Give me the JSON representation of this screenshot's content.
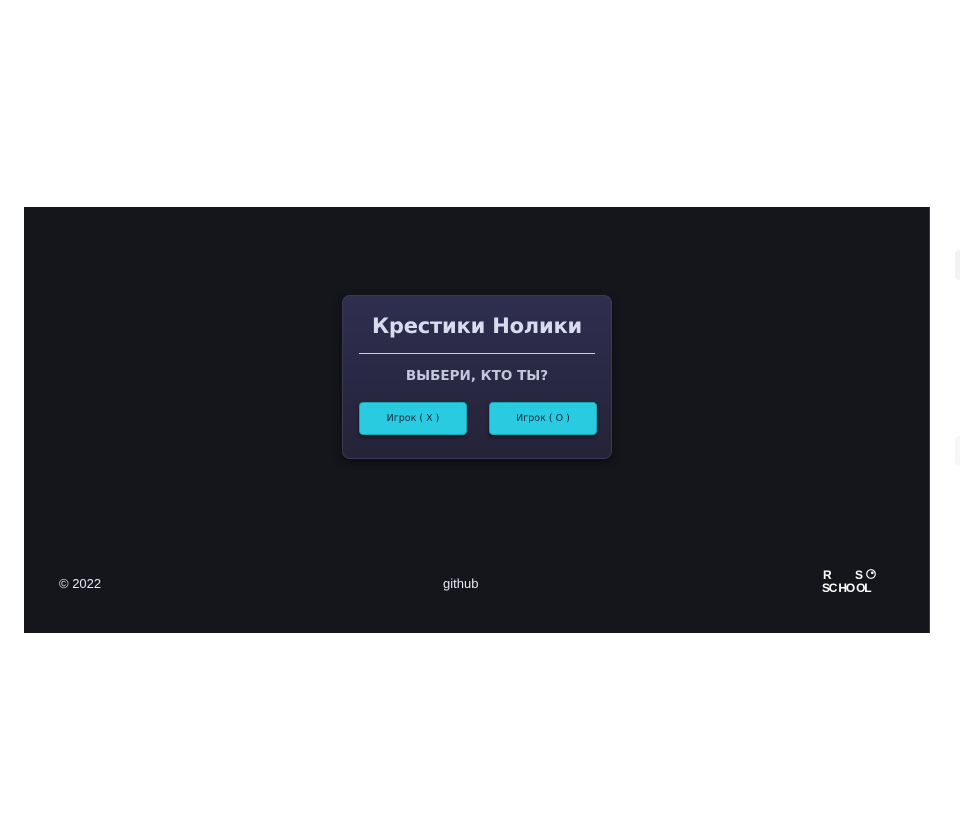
{
  "modal": {
    "title": "Крестики Нолики",
    "subtitle": "ВЫБЕРИ, КТО ТЫ?",
    "buttons": [
      {
        "label": "Игрок ( X )"
      },
      {
        "label": "Игрок ( O )"
      }
    ]
  },
  "footer": {
    "copyright": "© 2022",
    "github_label": "github",
    "logo": {
      "name": "rs-school-logo",
      "line1_left": "R",
      "line1_right": "S",
      "line2": "SC HO OL"
    }
  },
  "colors": {
    "app_background": "#15161b",
    "page_background": "#ffffff",
    "modal_top": "#2f2e4f",
    "modal_bottom": "#242338",
    "button": "#28cbe0",
    "title_text": "#d9dcef"
  }
}
